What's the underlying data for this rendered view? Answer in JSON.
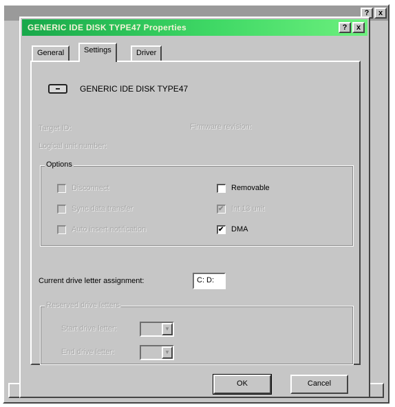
{
  "background_window": {
    "help_label": "?",
    "close_label": "x"
  },
  "dialog": {
    "title": "GENERIC IDE  DISK TYPE47 Properties",
    "help_label": "?",
    "close_label": "x",
    "tabs": [
      {
        "label": "General"
      },
      {
        "label": "Settings",
        "active": true
      },
      {
        "label": "Driver"
      }
    ],
    "device_name": "GENERIC IDE  DISK TYPE47",
    "target_id_label": "Target ID:",
    "logical_unit_label": "Logical unit number:",
    "firmware_label": "Firmware revision:",
    "options": {
      "label": "Options",
      "disconnect": {
        "label": "Disconnect",
        "checked": false,
        "enabled": false
      },
      "sync_transfer": {
        "label": "Sync data transfer",
        "checked": false,
        "enabled": false
      },
      "auto_insert": {
        "label": "Auto insert notification",
        "checked": false,
        "enabled": false
      },
      "removable": {
        "label": "Removable",
        "checked": false,
        "enabled": true
      },
      "int13": {
        "label": "Int 13 unit",
        "checked": true,
        "enabled": false
      },
      "dma": {
        "label": "DMA",
        "checked": true,
        "enabled": true
      }
    },
    "drive_letter_label": "Current drive letter assignment:",
    "drive_letter_value": "C: D:",
    "reserved": {
      "label": "Reserved drive letters",
      "start_label": "Start drive letter:",
      "end_label": "End drive letter:"
    },
    "ok_label": "OK",
    "cancel_label": "Cancel"
  },
  "colors": {
    "titlebar_start": "#18a84a",
    "titlebar_end": "#6df07e",
    "face": "#c6c6c6"
  }
}
